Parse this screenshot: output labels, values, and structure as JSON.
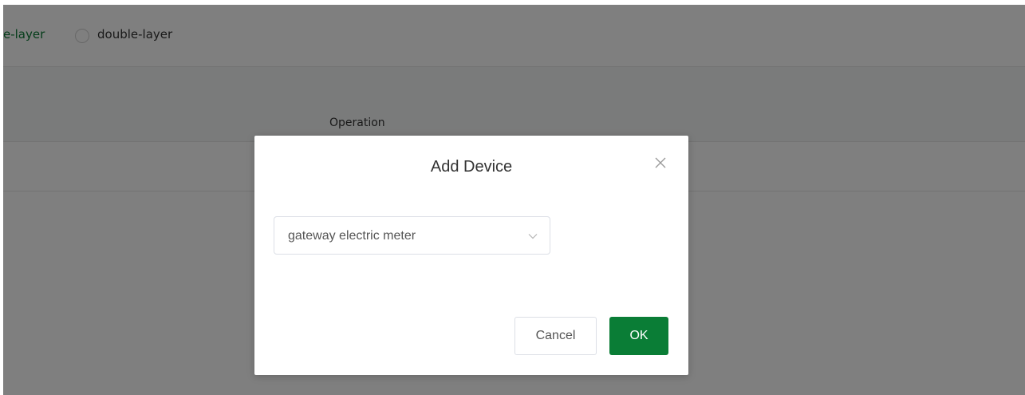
{
  "background": {
    "layer_options": {
      "single_label": "e-layer",
      "double_label": "double-layer"
    },
    "table": {
      "operation_header": "Operation"
    }
  },
  "dialog": {
    "title": "Add Device",
    "close_icon": "close-icon",
    "device_select": {
      "value": "gateway electric meter",
      "icon": "chevron-down-icon"
    },
    "cancel_label": "Cancel",
    "ok_label": "OK"
  },
  "colors": {
    "accent": "#0a7d36",
    "overlay": "rgba(0,0,0,0.5)"
  }
}
